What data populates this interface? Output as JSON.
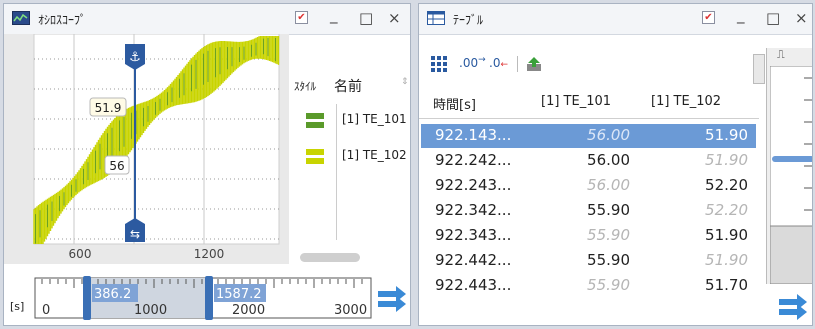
{
  "scope": {
    "title": "ｵｼﾛｽｺｰﾌﾟ",
    "legend": {
      "style_header": "ｽﾀｲﾙ",
      "name_header": "名前",
      "items": [
        {
          "name": "[1] TE_101",
          "color": "#5a9a2a"
        },
        {
          "name": "[1] TE_102",
          "color": "#c8d400"
        }
      ]
    },
    "cursor_values": {
      "a": "51.9",
      "b": "56"
    },
    "x_ticks": [
      "600",
      "1200"
    ],
    "overview": {
      "unit": "[s]",
      "ticks": [
        "0",
        "1000",
        "2000",
        "3000"
      ],
      "range_start": "386.2",
      "range_end": "1587.2"
    }
  },
  "table": {
    "title": "ﾃｰﾌﾞﾙ",
    "toolbar": {
      "dec_more": ".00",
      "dec_less": ".0"
    },
    "columns": [
      "時間[s]",
      "[1] TE_101",
      "[1] TE_102"
    ],
    "rows": [
      {
        "time": "922.143...",
        "te101": "56.00",
        "te102": "51.90",
        "dim101": true,
        "dim102": false,
        "selected": true
      },
      {
        "time": "922.242...",
        "te101": "56.00",
        "te102": "51.90",
        "dim101": false,
        "dim102": true,
        "selected": false
      },
      {
        "time": "922.243...",
        "te101": "56.00",
        "te102": "52.20",
        "dim101": true,
        "dim102": false,
        "selected": false
      },
      {
        "time": "922.342...",
        "te101": "55.90",
        "te102": "52.20",
        "dim101": false,
        "dim102": true,
        "selected": false
      },
      {
        "time": "922.343...",
        "te101": "55.90",
        "te102": "51.90",
        "dim101": true,
        "dim102": false,
        "selected": false
      },
      {
        "time": "922.442...",
        "te101": "55.90",
        "te102": "51.90",
        "dim101": false,
        "dim102": true,
        "selected": false
      },
      {
        "time": "922.443...",
        "te101": "55.90",
        "te102": "51.70",
        "dim101": true,
        "dim102": false,
        "selected": false
      }
    ]
  },
  "window_controls": {
    "minimize": "_",
    "maximize": "□",
    "close": "×"
  }
}
